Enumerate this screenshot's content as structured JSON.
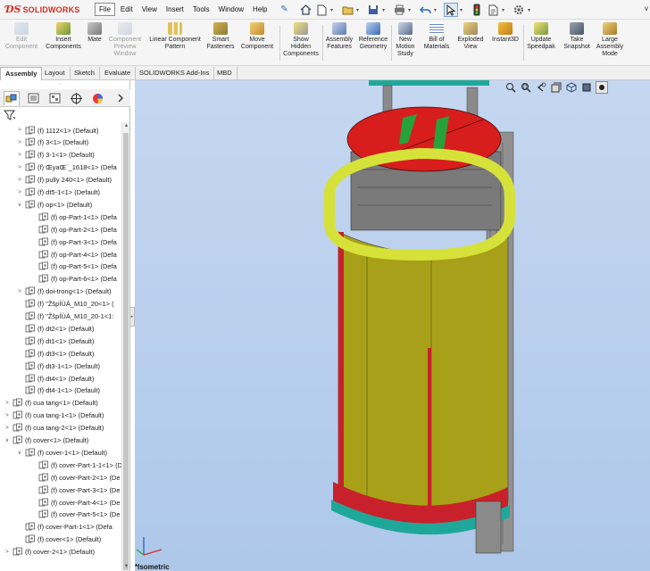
{
  "app": {
    "name": "SOLIDWORKS",
    "user_fragment": "v"
  },
  "menu": [
    {
      "label": "File",
      "active": true
    },
    {
      "label": "Edit"
    },
    {
      "label": "View"
    },
    {
      "label": "Insert"
    },
    {
      "label": "Tools"
    },
    {
      "label": "Window"
    },
    {
      "label": "Help"
    }
  ],
  "commands": [
    {
      "label": "Edit\nComponent",
      "disabled": true
    },
    {
      "label": "Insert\nComponents"
    },
    {
      "label": "Mate"
    },
    {
      "label": "Component\nPreview\nWindow",
      "disabled": true
    },
    {
      "label": "Linear Component\nPattern"
    },
    {
      "label": "Smart\nFasteners"
    },
    {
      "label": "Move\nComponent"
    },
    {
      "label": "Show\nHidden\nComponents"
    },
    {
      "label": "Assembly\nFeatures"
    },
    {
      "label": "Reference\nGeometry"
    },
    {
      "label": "New\nMotion\nStudy"
    },
    {
      "label": "Bill of\nMaterials"
    },
    {
      "label": "Exploded\nView"
    },
    {
      "label": "Instant3D"
    },
    {
      "label": "Update\nSpeedpak"
    },
    {
      "label": "Take\nSnapshot"
    },
    {
      "label": "Large\nAssembly\nMode"
    }
  ],
  "tabs": [
    {
      "label": "Assembly",
      "active": true
    },
    {
      "label": "Layout"
    },
    {
      "label": "Sketch"
    },
    {
      "label": "Evaluate"
    },
    {
      "label": "SOLIDWORKS Add-Ins"
    },
    {
      "label": "MBD"
    }
  ],
  "tree": [
    {
      "label": "(f) 1112<1> (Default)",
      "level": 1,
      "expander": ">"
    },
    {
      "label": "(f) 3<1> (Default)",
      "level": 1,
      "expander": ">"
    },
    {
      "label": "(f) 3-1<1> (Default)",
      "level": 1,
      "expander": ">"
    },
    {
      "label": "(f) ŒyaŒ´_1618<1> (Defa",
      "level": 1,
      "expander": ">"
    },
    {
      "label": "(f) pully 240<1> (Default)",
      "level": 1,
      "expander": ">"
    },
    {
      "label": "(f) dt5-1<1> (Default)",
      "level": 1,
      "expander": ">"
    },
    {
      "label": "(f) op<1> (Default)",
      "level": 1,
      "expander": "v"
    },
    {
      "label": "(f) op-Part-1<1> (Defa",
      "level": 2,
      "expander": ""
    },
    {
      "label": "(f) op-Part-2<1> (Defa",
      "level": 2,
      "expander": ""
    },
    {
      "label": "(f) op-Part-3<1> (Defa",
      "level": 2,
      "expander": ""
    },
    {
      "label": "(f) op-Part-4<1> (Defa",
      "level": 2,
      "expander": ""
    },
    {
      "label": "(f) op-Part-5<1> (Defa",
      "level": 2,
      "expander": ""
    },
    {
      "label": "(f) op-Part-6<1> (Defa",
      "level": 2,
      "expander": ""
    },
    {
      "label": "(f) doi-trong<1> (Default)",
      "level": 1,
      "expander": ">"
    },
    {
      "label": "(f) \"ŽŝpÍÙÀ_M10_20<1> (",
      "level": 1,
      "expander": ""
    },
    {
      "label": "(f) \"ŽŝpÍÙÀ_M10_20-1<1:",
      "level": 1,
      "expander": ""
    },
    {
      "label": "(f) dt2<1> (Default)",
      "level": 1,
      "expander": ""
    },
    {
      "label": "(f) dt1<1> (Default)",
      "level": 1,
      "expander": ""
    },
    {
      "label": "(f) dt3<1> (Default)",
      "level": 1,
      "expander": ""
    },
    {
      "label": "(f) dt3-1<1> (Default)",
      "level": 1,
      "expander": ""
    },
    {
      "label": "(f) dt4<1> (Default)",
      "level": 1,
      "expander": ""
    },
    {
      "label": "(f) dt4-1<1> (Default)",
      "level": 1,
      "expander": ""
    },
    {
      "label": "(f) cua tang<1> (Default)",
      "level": 0,
      "expander": ">"
    },
    {
      "label": "(f) cua tang-1<1> (Default)",
      "level": 0,
      "expander": ">"
    },
    {
      "label": "(f) cua tang-2<1> (Default)",
      "level": 0,
      "expander": ">"
    },
    {
      "label": "(f) cover<1> (Default)",
      "level": 0,
      "expander": "v"
    },
    {
      "label": "(f) cover-1<1> (Default)",
      "level": 1,
      "expander": "v"
    },
    {
      "label": "(f) cover-Part-1-1<1> (D",
      "level": 2,
      "expander": ""
    },
    {
      "label": "(f) cover-Part-2<1> (De",
      "level": 2,
      "expander": ""
    },
    {
      "label": "(f) cover-Part-3<1> (De",
      "level": 2,
      "expander": ""
    },
    {
      "label": "(f) cover-Part-4<1> (De",
      "level": 2,
      "expander": ""
    },
    {
      "label": "(f) cover-Part-5<1> (De",
      "level": 2,
      "expander": ""
    },
    {
      "label": "(f) cover-Part-1<1> (Defa",
      "level": 1,
      "expander": ""
    },
    {
      "label": "(f) cover<1> (Default)",
      "level": 1,
      "expander": ""
    },
    {
      "label": "(f) cover-2<1> (Default)",
      "level": 0,
      "expander": ">"
    }
  ],
  "viewport": {
    "view_label": "*Isometric"
  },
  "colors": {
    "top_red": "#d81d1d",
    "ring_yellow": "#d6e23a",
    "body_olive": "#a8a018",
    "base_teal": "#1fa89a",
    "steel": "#8a8a8a",
    "accent_green": "#27a13a"
  }
}
